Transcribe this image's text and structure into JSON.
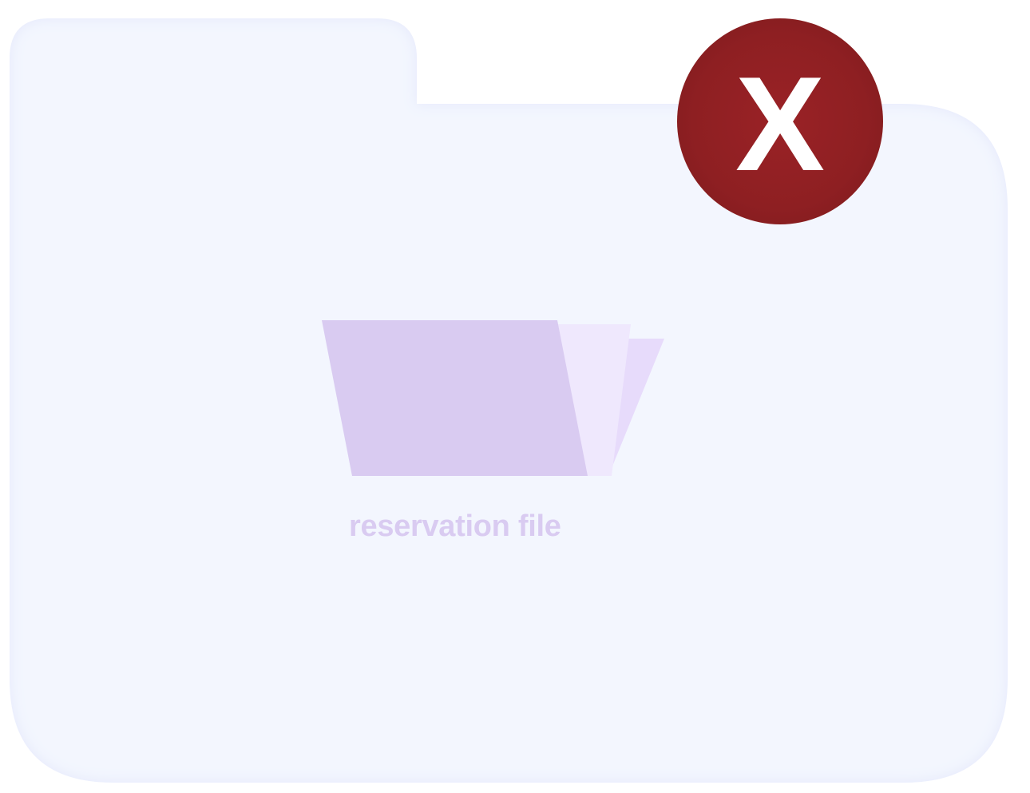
{
  "folder": {
    "label": "reservation file",
    "icon": "open-folder-icon",
    "colors": {
      "folder_bg": "#f3f6fe",
      "folder_edge": "#e6e9fb",
      "icon_front": "#d9cbf1",
      "icon_back": "#efe8fd",
      "icon_flap": "#e7dbfb",
      "label": "#d9cbf1"
    }
  },
  "close_button": {
    "glyph": "X",
    "icon": "close-icon",
    "color": "#8e1f22"
  }
}
